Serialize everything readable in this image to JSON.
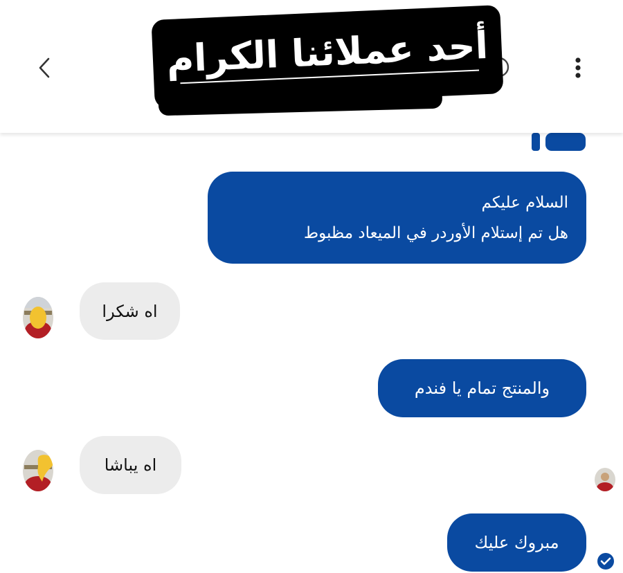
{
  "header": {
    "caption": "أحد عملائنا الكرام"
  },
  "messages": [
    {
      "direction": "outgoing",
      "lines": [
        "السلام عليكم",
        "هل تم إستلام الأوردر في الميعاد مظبوط"
      ]
    },
    {
      "direction": "incoming",
      "text": "اه شكرا"
    },
    {
      "direction": "outgoing",
      "text": "والمنتج تمام يا فندم"
    },
    {
      "direction": "incoming",
      "text": "اه يباشا"
    },
    {
      "direction": "outgoing",
      "text": "مبروك عليك"
    }
  ],
  "colors": {
    "outgoing_bubble": "#0a4aa1",
    "incoming_bubble": "#ececec",
    "caption_background": "#000000",
    "caption_text": "#ffffff",
    "censor_mark": "#f2c230"
  },
  "icons": [
    "back-chevron-icon",
    "more-vertical-icon",
    "info-icon",
    "read-receipt-icon"
  ]
}
